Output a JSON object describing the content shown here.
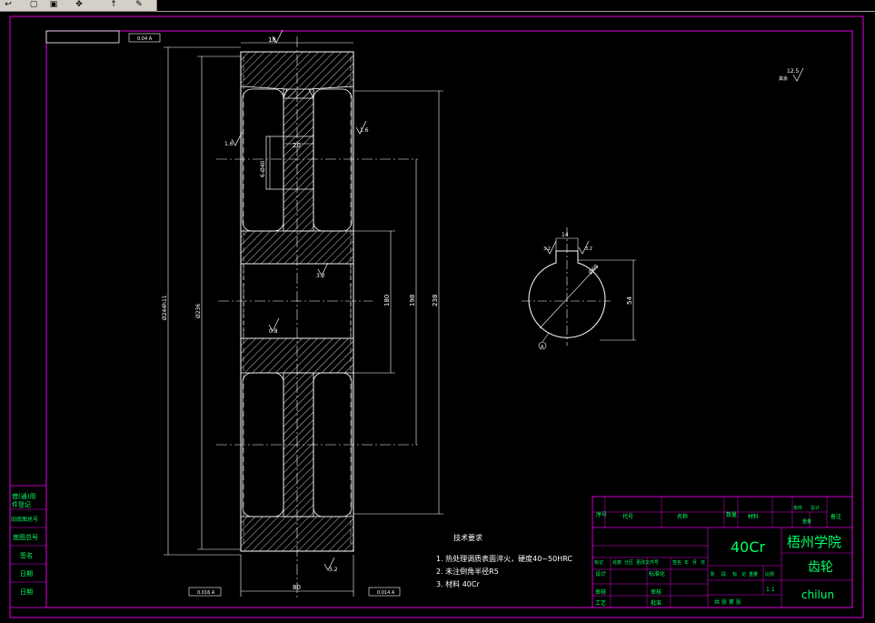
{
  "toolbar": {
    "icons": [
      "undo-icon",
      "new-doc-icon",
      "save-doc-icon",
      "pan-icon",
      "pointer-icon",
      "paint-icon"
    ]
  },
  "colors": {
    "frame": "#e000e0",
    "drawing": "#ffffff",
    "table_text": "#00ff66",
    "background": "#000000"
  },
  "dimensions": {
    "top_width": "18",
    "hub_offset": "20",
    "keyway_spec": "6-Ø40",
    "outer_dia": "Ø244h11",
    "pitch_dia": "Ø236",
    "dim_180": "180",
    "dim_198": "198",
    "dim_238": "238",
    "bottom_width": "80",
    "gdt_top": "0.04 A",
    "gdt_bottom_left": "0.016 A",
    "gdt_bottom_right": "0.014 A",
    "rough_16a": "1.6",
    "rough_16b": "1.6",
    "rough_32": "3.2",
    "rough_08": "0.8",
    "rough_32b": "3.2",
    "rough_125": "12.5",
    "rough_other": "其余"
  },
  "section": {
    "keyway_width": "14",
    "dia_label": "Ø60",
    "depth": "54",
    "rough_a": "3.2",
    "rough_b": "3.2",
    "datum": "A"
  },
  "tech": {
    "title": "技术要求",
    "items": [
      "1. 热处理调质表面淬火，硬度40~50HRC",
      "2. 未注倒角半径R5",
      "3. 材料 40Cr"
    ]
  },
  "left_strip": [
    "借(通)用",
    "件登记",
    "旧底图总号",
    "底图总号",
    "签名",
    "日期",
    "日期"
  ],
  "title_block": {
    "header": [
      "序号",
      "代号",
      "名称",
      "数量",
      "材料",
      "单件",
      "总计",
      "备注"
    ],
    "subheader": "重量",
    "material": "40Cr",
    "school": "梧州学院",
    "part_name": "齿轮",
    "drawing_no": "chilun",
    "revision_row": [
      "标记",
      "处数",
      "分区",
      "更改文件号",
      "签名",
      "年",
      "月",
      "日"
    ],
    "roles": [
      "设计",
      "标准化",
      "审核",
      "工艺",
      "审核",
      "批准"
    ],
    "stage_row": [
      "阶",
      "段",
      "标",
      "记",
      "重量",
      "比例"
    ],
    "scale": "1:1",
    "sheet": "共 张 第 张"
  }
}
